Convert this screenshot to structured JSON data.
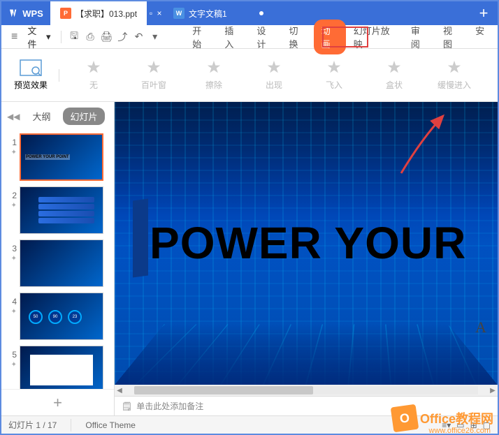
{
  "app": {
    "name": "WPS"
  },
  "tabs": [
    {
      "label": "【求职】013.ppt",
      "icon": "P",
      "active": true
    },
    {
      "label": "文字文稿1",
      "icon": "W",
      "active": false
    }
  ],
  "file_menu": "文件",
  "menu": {
    "items": [
      "开始",
      "插入",
      "设计",
      "切换",
      "动画",
      "幻灯片放映",
      "审阅",
      "视图",
      "安"
    ],
    "active_index": 4
  },
  "ribbon": {
    "preview": "预览效果",
    "animations": [
      "无",
      "百叶窗",
      "擦除",
      "出现",
      "飞入",
      "盒状",
      "缓慢进入"
    ]
  },
  "sidebar": {
    "outline": "大纲",
    "slides": "幻灯片",
    "thumbs": [
      {
        "num": "1",
        "text": "POWER YOUR POINT"
      },
      {
        "num": "2"
      },
      {
        "num": "3"
      },
      {
        "num": "4",
        "circles": [
          "50",
          "90",
          "23"
        ]
      },
      {
        "num": "5"
      }
    ]
  },
  "slide": {
    "headline": "POWER YOUR",
    "marker": "A"
  },
  "notes": {
    "placeholder": "单击此处添加备注"
  },
  "status": {
    "slide_info": "幻灯片 1 / 17",
    "theme": "Office Theme"
  },
  "watermark": {
    "brand": "Office教程网",
    "url": "www.office26.com"
  }
}
